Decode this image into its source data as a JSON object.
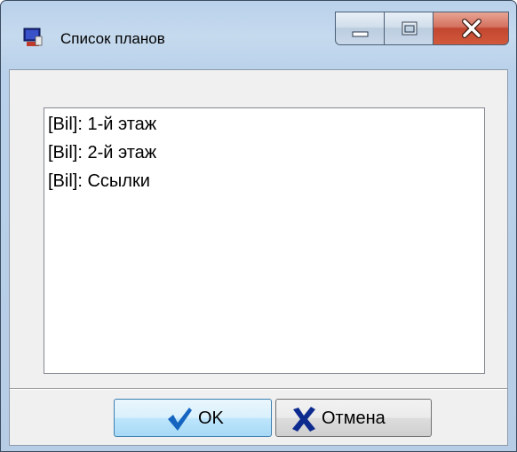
{
  "window": {
    "title": "Список планов",
    "icon": "app-window-icon",
    "caption_buttons": [
      "minimize-icon",
      "maximize-icon",
      "close-icon"
    ]
  },
  "plans_list": {
    "items": [
      {
        "label": "[Bil]: 1-й этаж"
      },
      {
        "label": "[Bil]: 2-й этаж"
      },
      {
        "label": "[Bil]: Ссылки"
      }
    ]
  },
  "buttons": {
    "ok": {
      "label": "OK",
      "icon": "checkmark-icon",
      "icon_color": "#1565c0"
    },
    "cancel": {
      "label": "Отмена",
      "icon": "cross-icon",
      "icon_color": "#0d2b8f"
    }
  },
  "colors": {
    "close_button": "#c9533a",
    "frame": "#b9d1ea"
  }
}
